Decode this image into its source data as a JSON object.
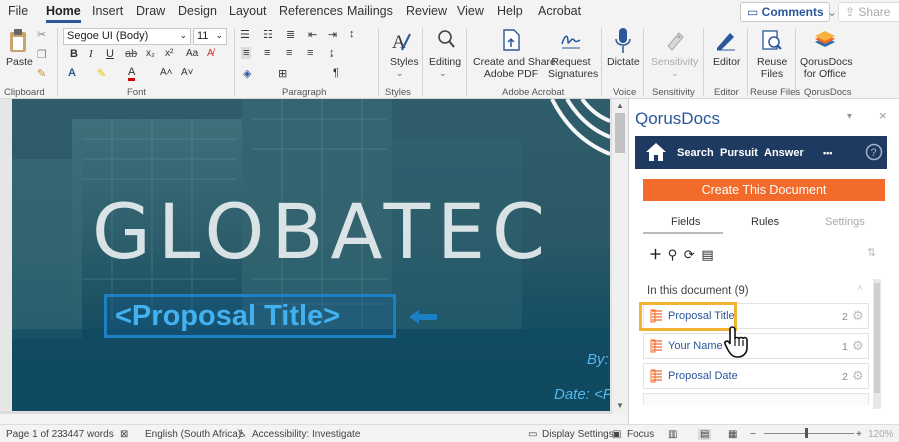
{
  "menubar": {
    "tabs": [
      "File",
      "Home",
      "Insert",
      "Draw",
      "Design",
      "Layout",
      "References",
      "Mailings",
      "Review",
      "View",
      "Help",
      "Acrobat"
    ],
    "active": "Home",
    "comments_label": "Comments",
    "share_label": "Share"
  },
  "ribbon": {
    "clipboard": {
      "paste_label": "Paste",
      "group_label": "Clipboard"
    },
    "font": {
      "font_name": "Segoe UI (Body)",
      "font_size": "11",
      "group_label": "Font"
    },
    "paragraph": {
      "group_label": "Paragraph"
    },
    "styles": {
      "label": "Styles",
      "group_label": "Styles"
    },
    "editing": {
      "label": "Editing"
    },
    "acrobat": {
      "create_share_line1": "Create and Share",
      "create_share_line2": "Adobe PDF",
      "request_line1": "Request",
      "request_line2": "Signatures",
      "group_label": "Adobe Acrobat"
    },
    "voice": {
      "dictate_label": "Dictate",
      "group_label": "Voice"
    },
    "sensitivity": {
      "label": "Sensitivity",
      "group_label": "Sensitivity"
    },
    "editor": {
      "label": "Editor",
      "group_label": "Editor"
    },
    "reuse": {
      "line1": "Reuse",
      "line2": "Files",
      "group_label": "Reuse Files"
    },
    "qorus": {
      "line1": "QorusDocs",
      "line2": "for Office",
      "group_label": "QorusDocs"
    }
  },
  "document": {
    "brand": "GLOBATEC",
    "proposal_title": "<Proposal Title>",
    "by_label": "By:",
    "date_label": "Date: <P"
  },
  "statusbar": {
    "page": "Page 1 of 23",
    "words": "3447 words",
    "language": "English (South Africa)",
    "accessibility": "Accessibility: Investigate",
    "display_settings": "Display Settings",
    "focus": "Focus",
    "zoom": "120%"
  },
  "pane": {
    "title": "QorusDocs",
    "nav": {
      "search": "Search",
      "pursuit": "Pursuit",
      "answer": "Answer",
      "more": "•••"
    },
    "create_button": "Create This Document",
    "tabs": [
      "Fields",
      "Rules",
      "Settings"
    ],
    "in_this_document": "In this document (9)",
    "fields": [
      {
        "name": "Proposal Title",
        "count": "2"
      },
      {
        "name": "Your Name",
        "count": "1"
      },
      {
        "name": "Proposal Date",
        "count": "2"
      }
    ]
  },
  "colors": {
    "word_blue": "#2b579a",
    "qorus_navy": "#1f3a60",
    "qorus_orange": "#f26b2a",
    "highlight": "#f2b233",
    "doc_title_blue": "#41b1ef"
  }
}
